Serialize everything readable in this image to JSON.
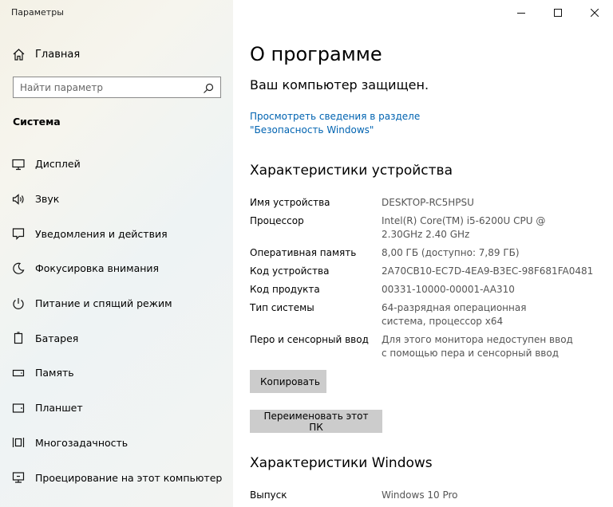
{
  "window": {
    "title": "Параметры"
  },
  "sidebar": {
    "home_label": "Главная",
    "search_placeholder": "Найти параметр",
    "section_title": "Система",
    "items": [
      {
        "label": "Дисплей",
        "icon": "display-icon"
      },
      {
        "label": "Звук",
        "icon": "speaker-icon"
      },
      {
        "label": "Уведомления и действия",
        "icon": "notification-icon"
      },
      {
        "label": "Фокусировка внимания",
        "icon": "moon-icon"
      },
      {
        "label": "Питание и спящий режим",
        "icon": "power-icon"
      },
      {
        "label": "Батарея",
        "icon": "battery-icon"
      },
      {
        "label": "Память",
        "icon": "storage-icon"
      },
      {
        "label": "Планшет",
        "icon": "tablet-icon"
      },
      {
        "label": "Многозадачность",
        "icon": "multitasking-icon"
      },
      {
        "label": "Проецирование на этот компьютер",
        "icon": "projecting-icon"
      }
    ]
  },
  "main": {
    "title": "О программе",
    "protected_text": "Ваш компьютер защищен.",
    "security_link": "Просмотреть сведения в разделе \"Безопасность Windows\"",
    "device_specs_heading": "Характеристики устройства",
    "device_specs": [
      {
        "key": "Имя устройства",
        "value": "DESKTOP-RC5HPSU"
      },
      {
        "key": "Процессор",
        "value": "Intel(R) Core(TM) i5-6200U CPU @ 2.30GHz 2.40 GHz"
      },
      {
        "key": "Оперативная память",
        "value": "8,00 ГБ (доступно: 7,89 ГБ)"
      },
      {
        "key": "Код устройства",
        "value": "2A70CB10-EC7D-4EA9-B3EC-98F681FA0481"
      },
      {
        "key": "Код продукта",
        "value": "00331-10000-00001-AA310"
      },
      {
        "key": "Тип системы",
        "value": "64-разрядная операционная система, процессор x64"
      },
      {
        "key": "Перо и сенсорный ввод",
        "value": "Для этого монитора недоступен ввод с помощью пера и сенсорный ввод"
      }
    ],
    "copy_button": "Копировать",
    "rename_button": "Переименовать этот ПК",
    "windows_specs_heading": "Характеристики Windows",
    "windows_specs": [
      {
        "key": "Выпуск",
        "value": "Windows 10 Pro"
      }
    ]
  },
  "colors": {
    "link": "#0063b1",
    "button_bg": "#cccccc",
    "value_text": "#555555"
  }
}
